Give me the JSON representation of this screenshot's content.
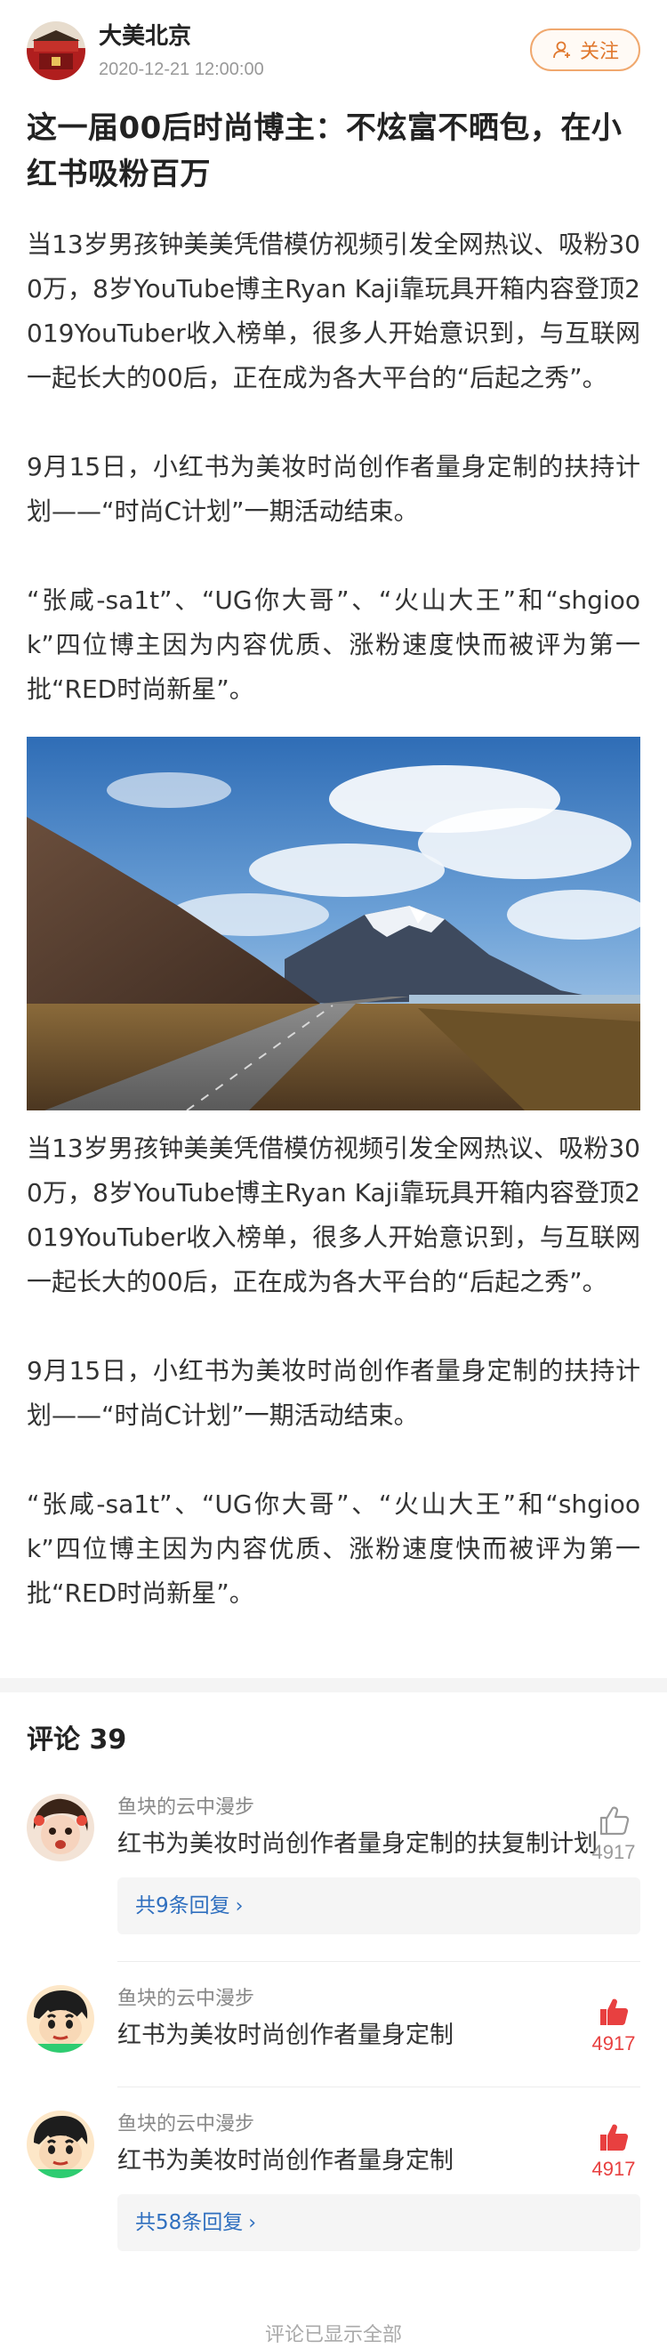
{
  "author": {
    "name": "大美北京",
    "time": "2020-12-21 12:00:00",
    "follow_label": "关注"
  },
  "article": {
    "title": "这一届00后时尚博主：不炫富不晒包，在小红书吸粉百万",
    "paragraphs": [
      "当13岁男孩钟美美凭借模仿视频引发全网热议、吸粉300万，8岁YouTube博主Ryan Kaji靠玩具开箱内容登顶2019YouTuber收入榜单，很多人开始意识到，与互联网一起长大的00后，正在成为各大平台的“后起之秀”。",
      "9月15日，小红书为美妆时尚创作者量身定制的扶持计划——“时尚C计划”一期活动结束。",
      "“张咸-sa1t”、“UG你大哥”、“火山大王”和“shgiook”四位博主因为内容优质、涨粉速度快而被评为第一批“RED时尚新星”。"
    ],
    "paragraphs_2": [
      "当13岁男孩钟美美凭借模仿视频引发全网热议、吸粉300万，8岁YouTube博主Ryan Kaji靠玩具开箱内容登顶2019YouTuber收入榜单，很多人开始意识到，与互联网一起长大的00后，正在成为各大平台的“后起之秀”。",
      "9月15日，小红书为美妆时尚创作者量身定制的扶持计划——“时尚C计划”一期活动结束。",
      "“张咸-sa1t”、“UG你大哥”、“火山大王”和“shgiook”四位博主因为内容优质、涨粉速度快而被评为第一批“RED时尚新星”。"
    ]
  },
  "comments": {
    "header": "评论 39",
    "items": [
      {
        "user": "鱼块的云中漫步",
        "text": "红书为美妆时尚创作者量身定制的扶复制计划",
        "likes": "4917",
        "liked": false,
        "replies": "共9条回复"
      },
      {
        "user": "鱼块的云中漫步",
        "text": "红书为美妆时尚创作者量身定制",
        "likes": "4917",
        "liked": true
      },
      {
        "user": "鱼块的云中漫步",
        "text": "红书为美妆时尚创作者量身定制",
        "likes": "4917",
        "liked": true,
        "replies": "共58条回复"
      }
    ],
    "footer": "评论已显示全部"
  },
  "colors": {
    "accent": "#e0782e",
    "like_red": "#e84040",
    "link_blue": "#2f6fbf"
  },
  "icons": {
    "follow": "user-plus-icon",
    "like": "thumbs-up-icon",
    "reply_more": "chevron-right-icon"
  }
}
